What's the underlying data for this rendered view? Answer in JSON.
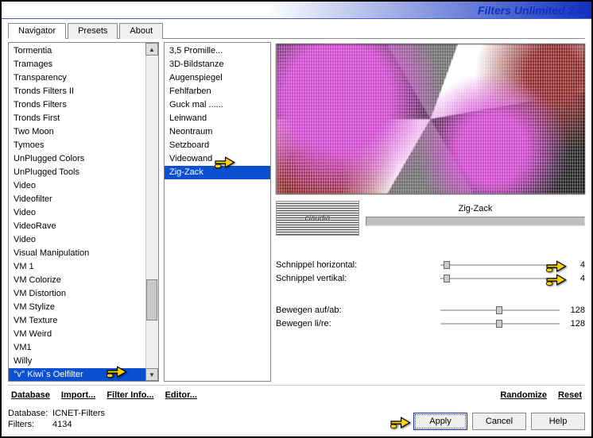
{
  "title": "Filters Unlimited 2.0",
  "tabs": [
    "Navigator",
    "Presets",
    "About"
  ],
  "active_tab": 0,
  "col1": {
    "items": [
      "Tormentia",
      "Tramages",
      "Transparency",
      "Tronds Filters II",
      "Tronds Filters",
      "Tronds First",
      "Two Moon",
      "Tymoes",
      "UnPlugged Colors",
      "UnPlugged Tools",
      "Video",
      "Videofilter",
      "Video",
      "VideoRave",
      "Video",
      "Visual Manipulation",
      "VM 1",
      "VM Colorize",
      "VM Distortion",
      "VM Stylize",
      "VM Texture",
      "VM Weird",
      "VM1",
      "Willy",
      "°v° Kiwi`s Oelfilter"
    ],
    "selected_index": 24
  },
  "col2": {
    "items": [
      "3,5 Promille...",
      "3D-Bildstanze",
      "Augenspiegel",
      "Fehlfarben",
      "Guck mal ......",
      "Leinwand",
      "Neontraum",
      "Setzboard",
      "Videowand",
      "Zig-Zack"
    ],
    "selected_index": 9
  },
  "logo_text": "claudia",
  "filter_name": "Zig-Zack",
  "params": [
    {
      "label": "Schnippel horizontal:",
      "value": "4",
      "pos": 0.03
    },
    {
      "label": "Schnippel vertikal:",
      "value": "4",
      "pos": 0.03
    }
  ],
  "params2": [
    {
      "label": "Bewegen auf/ab:",
      "value": "128",
      "pos": 0.5
    },
    {
      "label": "Bewegen li/re:",
      "value": "128",
      "pos": 0.5
    }
  ],
  "mid_buttons": {
    "database": "Database",
    "import": "Import...",
    "filter_info": "Filter Info...",
    "editor": "Editor...",
    "randomize": "Randomize",
    "reset": "Reset"
  },
  "db_info": {
    "database_k": "Database:",
    "database_v": "ICNET-Filters",
    "filters_k": "Filters:",
    "filters_v": "4134"
  },
  "buttons": {
    "apply": "Apply",
    "cancel": "Cancel",
    "help": "Help"
  }
}
